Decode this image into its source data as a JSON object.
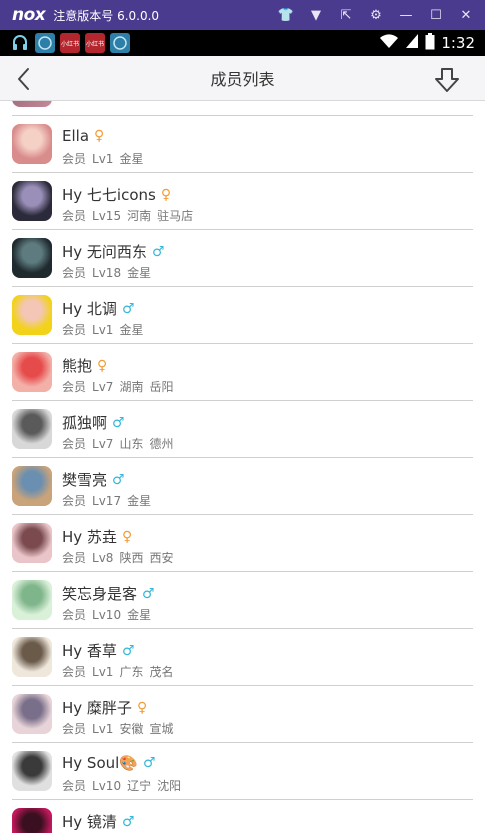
{
  "emulator": {
    "logo": "nox",
    "title": "注意版本号 6.0.0.0",
    "controls": [
      {
        "name": "shirt-icon",
        "glyph": "👕"
      },
      {
        "name": "menu-icon",
        "glyph": "▼"
      },
      {
        "name": "pin-icon",
        "glyph": "⇱"
      },
      {
        "name": "gear-icon",
        "glyph": "⚙"
      },
      {
        "name": "minimize-icon",
        "glyph": "—"
      },
      {
        "name": "maximize-icon",
        "glyph": "☐"
      },
      {
        "name": "close-icon",
        "glyph": "✕"
      }
    ]
  },
  "status_bar": {
    "notif_text": "小红书",
    "time": "1:32"
  },
  "header": {
    "title": "成员列表"
  },
  "members": [
    {
      "name": "Ella",
      "gender": "f",
      "gender_symbol": "♀",
      "role": "会员",
      "level": "Lv1",
      "location": [
        "金星"
      ],
      "avatar_colors": [
        "#d98c8c",
        "#f5d0c5"
      ]
    },
    {
      "name": "Hy 七七icons",
      "gender": "f",
      "gender_symbol": "♀",
      "role": "会员",
      "level": "Lv15",
      "location": [
        "河南",
        "驻马店"
      ],
      "avatar_colors": [
        "#2b2a3a",
        "#9a8fb8"
      ]
    },
    {
      "name": "Hy 无问西东",
      "gender": "m",
      "gender_symbol": "♂",
      "role": "会员",
      "level": "Lv18",
      "location": [
        "金星"
      ],
      "avatar_colors": [
        "#1f2a2e",
        "#5e7c80"
      ]
    },
    {
      "name": "Hy 北调",
      "gender": "m",
      "gender_symbol": "♂",
      "role": "会员",
      "level": "Lv1",
      "location": [
        "金星"
      ],
      "avatar_colors": [
        "#f2d21b",
        "#f3c6b6"
      ]
    },
    {
      "name": "熊抱",
      "gender": "f",
      "gender_symbol": "♀",
      "role": "会员",
      "level": "Lv7",
      "location": [
        "湖南",
        "岳阳"
      ],
      "avatar_colors": [
        "#f3b0a8",
        "#e64b4b"
      ]
    },
    {
      "name": "孤独啊",
      "gender": "m",
      "gender_symbol": "♂",
      "role": "会员",
      "level": "Lv7",
      "location": [
        "山东",
        "德州"
      ],
      "avatar_colors": [
        "#d8d8d8",
        "#5a5a5a"
      ]
    },
    {
      "name": "樊雪亮",
      "gender": "m",
      "gender_symbol": "♂",
      "role": "会员",
      "level": "Lv17",
      "location": [
        "金星"
      ],
      "avatar_colors": [
        "#c9a37a",
        "#6b8fb0"
      ]
    },
    {
      "name": "Hy 苏垚",
      "gender": "f",
      "gender_symbol": "♀",
      "role": "会员",
      "level": "Lv8",
      "location": [
        "陕西",
        "西安"
      ],
      "avatar_colors": [
        "#e9c4c8",
        "#7a4a4f"
      ]
    },
    {
      "name": "笑忘身是客",
      "gender": "m",
      "gender_symbol": "♂",
      "role": "会员",
      "level": "Lv10",
      "location": [
        "金星"
      ],
      "avatar_colors": [
        "#d9f0d9",
        "#7fb58a"
      ]
    },
    {
      "name": "Hy 香草",
      "gender": "m",
      "gender_symbol": "♂",
      "role": "会员",
      "level": "Lv1",
      "location": [
        "广东",
        "茂名"
      ],
      "avatar_colors": [
        "#efe7dc",
        "#6a5a4a"
      ]
    },
    {
      "name": "Hy 糜胖子",
      "gender": "f",
      "gender_symbol": "♀",
      "role": "会员",
      "level": "Lv1",
      "location": [
        "安徽",
        "宣城"
      ],
      "avatar_colors": [
        "#e8d4d8",
        "#7a6f8a"
      ]
    },
    {
      "name": "Hy Soul🎨",
      "gender": "m",
      "gender_symbol": "♂",
      "role": "会员",
      "level": "Lv10",
      "location": [
        "辽宁",
        "沈阳"
      ],
      "avatar_colors": [
        "#e0e0e0",
        "#3a3a3a"
      ]
    },
    {
      "name": "Hy 镜清",
      "gender": "m",
      "gender_symbol": "♂",
      "role": "会员",
      "level": "",
      "location": [],
      "avatar_colors": [
        "#c2185b",
        "#3a1020"
      ]
    }
  ]
}
